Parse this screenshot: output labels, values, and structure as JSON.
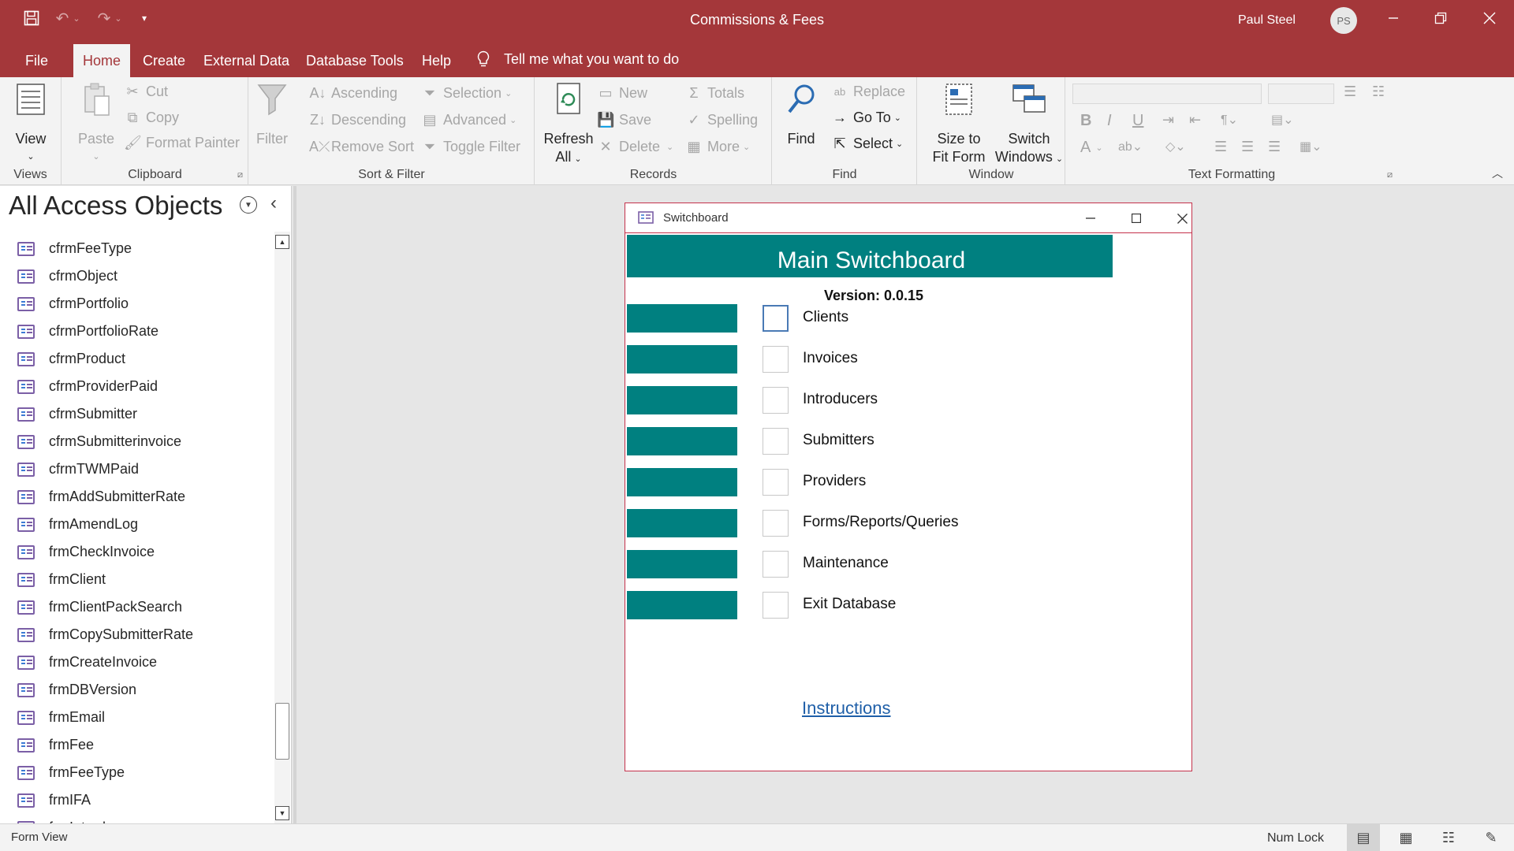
{
  "titlebar": {
    "app_title": "Commissions & Fees",
    "user_name": "Paul Steel",
    "user_initials": "PS",
    "icons": [
      "save-icon",
      "undo-icon",
      "redo-icon",
      "customize-qat-icon",
      "minimize-icon",
      "restore-icon",
      "close-icon"
    ]
  },
  "tabs": [
    {
      "label": "File"
    },
    {
      "label": "Home"
    },
    {
      "label": "Create"
    },
    {
      "label": "External Data"
    },
    {
      "label": "Database Tools"
    },
    {
      "label": "Help"
    }
  ],
  "tell_me": "Tell me what you want to do",
  "ribbon": {
    "views": {
      "label": "Views",
      "view": "View"
    },
    "clipboard": {
      "label": "Clipboard",
      "paste": "Paste",
      "cut": "Cut",
      "copy": "Copy",
      "format_painter": "Format Painter"
    },
    "sort_filter": {
      "label": "Sort & Filter",
      "filter": "Filter",
      "ascending": "Ascending",
      "descending": "Descending",
      "remove_sort": "Remove Sort",
      "selection": "Selection",
      "advanced": "Advanced",
      "toggle_filter": "Toggle Filter"
    },
    "records": {
      "label": "Records",
      "refresh_line1": "Refresh",
      "refresh_line2": "All",
      "new": "New",
      "save": "Save",
      "delete": "Delete",
      "totals": "Totals",
      "spelling": "Spelling",
      "more": "More"
    },
    "find": {
      "label": "Find",
      "find": "Find",
      "replace": "Replace",
      "go_to": "Go To",
      "select": "Select"
    },
    "window": {
      "label": "Window",
      "size_line1": "Size to",
      "size_line2": "Fit Form",
      "switch_line1": "Switch",
      "switch_line2": "Windows"
    },
    "text_formatting": {
      "label": "Text Formatting",
      "bold": "B",
      "italic": "I",
      "underline": "U",
      "font_color": "A"
    }
  },
  "nav": {
    "title": "All Access Objects",
    "items": [
      "cfrmFeeType",
      "cfrmObject",
      "cfrmPortfolio",
      "cfrmPortfolioRate",
      "cfrmProduct",
      "cfrmProviderPaid",
      "cfrmSubmitter",
      "cfrmSubmitterinvoice",
      "cfrmTWMPaid",
      "frmAddSubmitterRate",
      "frmAmendLog",
      "frmCheckInvoice",
      "frmClient",
      "frmClientPackSearch",
      "frmCopySubmitterRate",
      "frmCreateInvoice",
      "frmDBVersion",
      "frmEmail",
      "frmFee",
      "frmFeeType",
      "frmIFA",
      "frmIntroducer"
    ]
  },
  "switchboard": {
    "window_title": "Switchboard",
    "main_title": "Main Switchboard",
    "version": "Version: 0.0.15",
    "accent": "#008080",
    "items": [
      {
        "label": "Clients"
      },
      {
        "label": "Invoices"
      },
      {
        "label": "Introducers"
      },
      {
        "label": "Submitters"
      },
      {
        "label": "Providers"
      },
      {
        "label": "Forms/Reports/Queries"
      },
      {
        "label": "Maintenance"
      },
      {
        "label": "Exit Database"
      }
    ],
    "instructions": "Instructions"
  },
  "statusbar": {
    "left": "Form View",
    "num_lock": "Num Lock"
  },
  "colors": {
    "brand": "#a4373a",
    "accent": "#008080",
    "link": "#1f5fa8"
  }
}
